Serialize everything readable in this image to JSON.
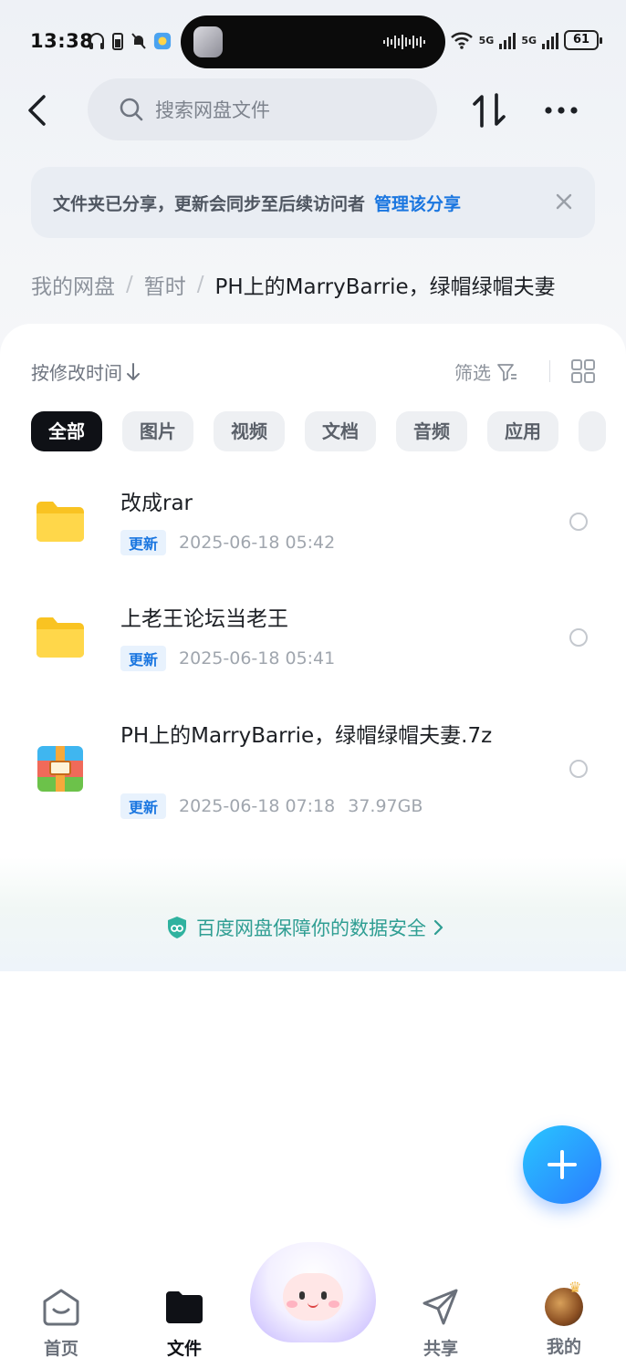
{
  "status_bar": {
    "time": "13:38",
    "signal1": "5G",
    "signal2": "5G",
    "battery": "61"
  },
  "header": {
    "search_placeholder": "搜索网盘文件"
  },
  "banner": {
    "text": "文件夹已分享，更新会同步至后续访问者",
    "link": "管理该分享"
  },
  "breadcrumb": {
    "items": [
      "我的网盘",
      "暂时"
    ],
    "current": "PH上的MarryBarrie，绿帽绿帽夫妻"
  },
  "toolbar": {
    "sort_label": "按修改时间",
    "filter_label": "筛选"
  },
  "chips": [
    "全部",
    "图片",
    "视频",
    "文档",
    "音频",
    "应用"
  ],
  "files": [
    {
      "name": "改成rar",
      "badge": "更新",
      "date": "2025-06-18  05:42",
      "size": "",
      "type": "folder"
    },
    {
      "name": "上老王论坛当老王",
      "badge": "更新",
      "date": "2025-06-18  05:41",
      "size": "",
      "type": "folder"
    },
    {
      "name": "PH上的MarryBarrie，绿帽绿帽夫妻.7z",
      "badge": "更新",
      "date": "2025-06-18  07:18",
      "size": "37.97GB",
      "type": "archive"
    }
  ],
  "security": {
    "text": "百度网盘保障你的数据安全"
  },
  "nav": {
    "home": "首页",
    "files": "文件",
    "share": "共享",
    "me": "我的"
  },
  "colors": {
    "accent": "#1a76e0",
    "secure": "#2f9e93",
    "chip_active": "#0f1116",
    "fab": "#2a7bff"
  }
}
